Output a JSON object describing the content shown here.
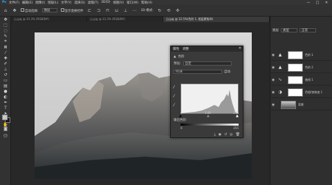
{
  "menu": [
    "文件(F)",
    "编辑(E)",
    "图像(I)",
    "图层(L)",
    "文字(Y)",
    "选择(S)",
    "滤镜(T)",
    "3D(D)",
    "视图(V)",
    "窗口(W)",
    "帮助(H)"
  ],
  "window_controls": {
    "minimize": "—",
    "maximize": "□",
    "close": "✕"
  },
  "options": {
    "auto_select_label": "自动选择:",
    "auto_select_value": "图层",
    "transform_label": "显示变换控件",
    "mode_label": "3D 模式:"
  },
  "tabs": [
    {
      "label": "山.jpg @ 33.3% (RGB/8#)",
      "active": false
    },
    {
      "label": "山.jpg @ 33.3% (RGB/8#)",
      "active": false
    },
    {
      "label": "山.jpg @ 12.5%(色阶 1, 图层蒙版/8)",
      "active": true
    }
  ],
  "properties": {
    "tab1": "属性",
    "tab2": "调整",
    "header_label": "色阶",
    "preset_label": "预设:",
    "preset_value": "自定",
    "channel_value": "RGB",
    "auto_label": "自动",
    "input_low": "0",
    "input_mid": "1.00",
    "input_high": "255",
    "output_label": "输出色阶:",
    "output_low": "0",
    "output_high": "255"
  },
  "layers": {
    "tab": "图层",
    "filter": "类型",
    "blend": "正常",
    "items": [
      {
        "name": "色阶 1",
        "icon": "levels-icon"
      },
      {
        "name": "色阶 2",
        "icon": "levels-icon"
      },
      {
        "name": "曲线 1",
        "icon": "curves-icon"
      },
      {
        "name": "色相/饱和度 1",
        "icon": "hue-saturation-icon"
      },
      {
        "name": "背景",
        "icon": "background-thumbnail"
      }
    ]
  },
  "colors": {
    "panel_bg": "#3a3a3a",
    "app_bg": "#282828",
    "histogram_fill": "#9a9a9a"
  }
}
